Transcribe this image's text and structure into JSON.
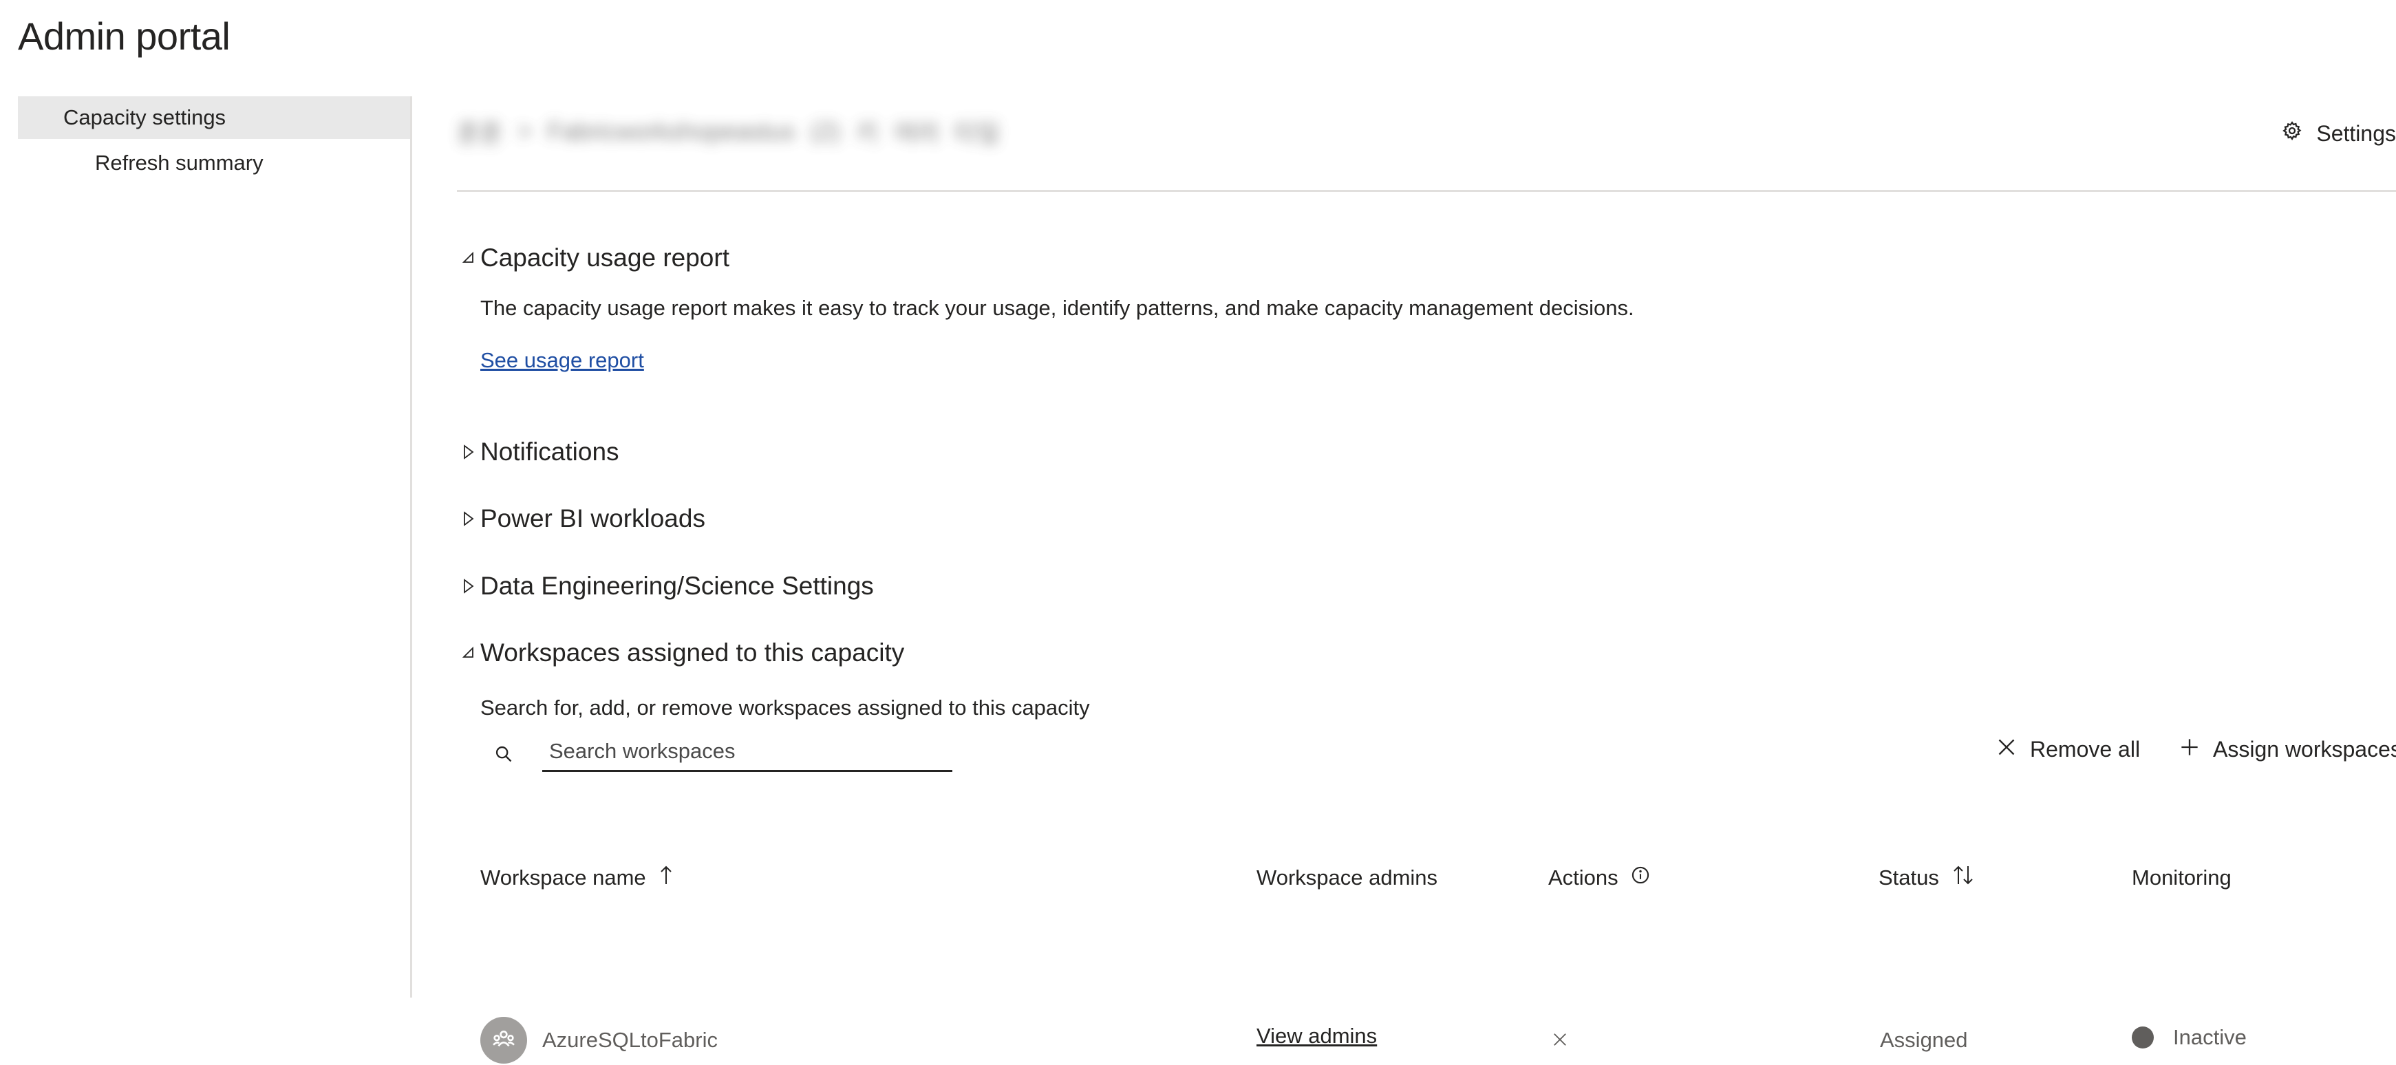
{
  "page_title": "Admin portal",
  "left_nav": {
    "items": [
      {
        "label": "Capacity settings",
        "active": true
      },
      {
        "label": "Refresh summary",
        "active": false
      }
    ]
  },
  "header": {
    "breadcrumb_parts": [
      "훈훈",
      ">",
      "Fabricworkshopeastus",
      "(2)",
      "키",
      "여러",
      "타일"
    ],
    "settings_label": "Settings"
  },
  "sections": {
    "capacity_usage": {
      "title": "Capacity usage report",
      "description": "The capacity usage report makes it easy to track your usage, identify patterns, and make capacity management decisions.",
      "link_label": "See usage report",
      "expanded": true
    },
    "notifications": {
      "title": "Notifications",
      "expanded": false
    },
    "powerbi_workloads": {
      "title": "Power BI workloads",
      "expanded": false
    },
    "data_engineering": {
      "title": "Data Engineering/Science Settings",
      "expanded": false
    },
    "workspaces": {
      "title": "Workspaces assigned to this capacity",
      "description": "Search for, add, or remove workspaces assigned to this capacity",
      "expanded": true,
      "search_placeholder": "Search workspaces",
      "remove_all_label": "Remove all",
      "assign_label": "Assign workspaces",
      "columns": {
        "name": "Workspace name",
        "admins": "Workspace admins",
        "actions": "Actions",
        "status": "Status",
        "monitoring": "Monitoring"
      },
      "rows": [
        {
          "name": "AzureSQLtoFabric",
          "admins_link": "View admins",
          "status": "Assigned",
          "monitoring": "Inactive"
        }
      ]
    }
  },
  "colors": {
    "link": "#1f4ea3",
    "nav_active_bg": "#e8e8e8",
    "divider": "#e1dfdd",
    "avatar_bg": "#a19f9d",
    "status_dot": "#605e5c"
  }
}
